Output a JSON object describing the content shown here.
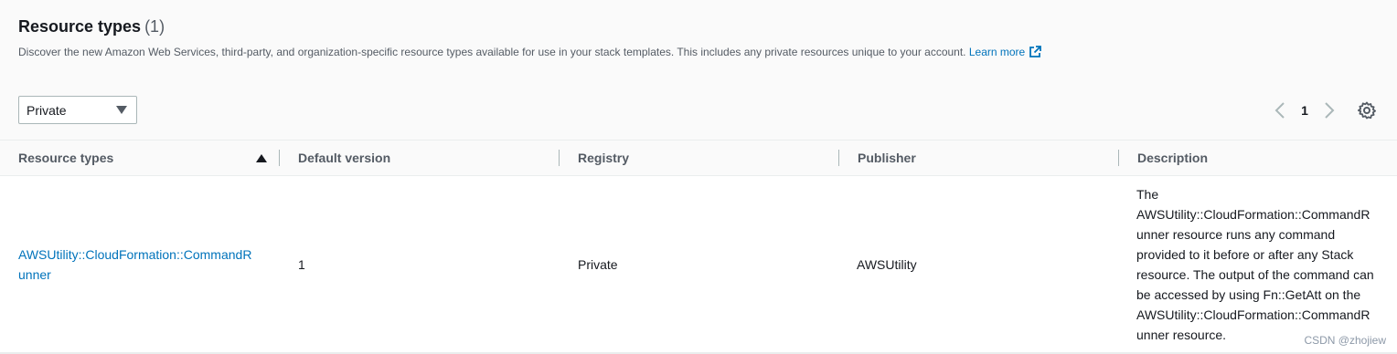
{
  "header": {
    "title": "Resource types",
    "count": "(1)",
    "description": "Discover the new Amazon Web Services, third-party, and organization-specific resource types available for use in your stack templates. This includes any private resources unique to your account.",
    "learn_more": "Learn more",
    "learn_more_icon": "external-link-icon"
  },
  "filter": {
    "selected": "Private"
  },
  "pagination": {
    "current_page": "1"
  },
  "table": {
    "columns": [
      "Resource types",
      "Default version",
      "Registry",
      "Publisher",
      "Description"
    ],
    "sort": {
      "column": "Resource types",
      "direction": "ascending"
    },
    "rows": [
      {
        "resource_type_line1": "AWSUtility::CloudFormation::CommandR",
        "resource_type_line2": "unner",
        "default_version": "1",
        "registry": "Private",
        "publisher": "AWSUtility",
        "description_lines": [
          "The",
          "AWSUtility::CloudFormation::CommandR",
          "unner resource runs any command",
          "provided to it before or after any Stack",
          "resource. The output of the command can",
          "be accessed by using Fn::GetAtt on the",
          "AWSUtility::CloudFormation::CommandR",
          "unner resource."
        ]
      }
    ]
  },
  "watermark": "CSDN @zhojiew",
  "colors": {
    "link": "#0073bb",
    "text": "#16191f",
    "muted": "#545b64",
    "header_bg": "#fafafa"
  }
}
